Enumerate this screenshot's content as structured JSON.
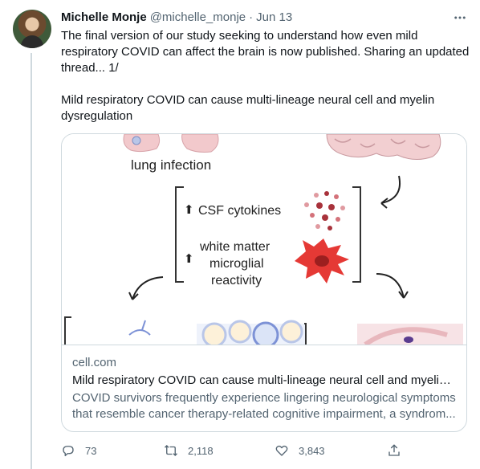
{
  "tweet": {
    "author_name": "Michelle Monje",
    "author_handle": "@michelle_monje",
    "separator": "·",
    "date": "Jun 13",
    "text_paragraph_1": "The final version of our study seeking to understand how even mild respiratory COVID can affect the brain is now published. Sharing an updated thread... 1/",
    "text_paragraph_2": "Mild respiratory COVID can cause multi-lineage neural cell and myelin dysregulation"
  },
  "card": {
    "figure_labels": {
      "lung": "lung infection",
      "csf": "CSF cytokines",
      "white_matter_1": "white matter",
      "white_matter_2": "microglial",
      "white_matter_3": "reactivity",
      "up_arrow": "⬆"
    },
    "domain": "cell.com",
    "title": "Mild respiratory COVID can cause multi-lineage neural cell and myelin ...",
    "description_line_1": "COVID survivors frequently experience lingering neurological symptoms",
    "description_line_2": "that resemble cancer therapy-related cognitive impairment, a syndrom..."
  },
  "actions": {
    "reply_count": "73",
    "retweet_count": "2,118",
    "like_count": "3,843"
  },
  "icons": {
    "more": "more-horizontal-icon",
    "reply": "reply-icon",
    "retweet": "retweet-icon",
    "like": "heart-icon",
    "share": "share-icon"
  },
  "colors": {
    "text_primary": "#0f1419",
    "text_secondary": "#536471",
    "border": "#cfd9de",
    "microglia_red": "#e53935",
    "tissue_pink": "#f2c9cc"
  }
}
